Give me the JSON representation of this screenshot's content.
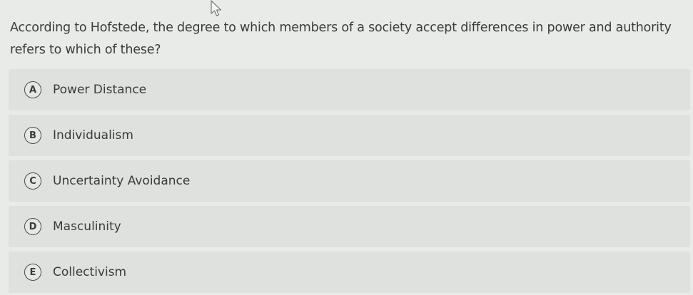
{
  "question": {
    "text": "According to Hofstede, the degree to which members of a society accept differences in power and authority refers to which of these?"
  },
  "options": [
    {
      "letter": "A",
      "label": "Power Distance"
    },
    {
      "letter": "B",
      "label": "Individualism"
    },
    {
      "letter": "C",
      "label": "Uncertainty Avoidance"
    },
    {
      "letter": "D",
      "label": "Masculinity"
    },
    {
      "letter": "E",
      "label": "Collectivism"
    }
  ],
  "colors": {
    "background": "#e9ebe8",
    "option_background": "#dfe1de",
    "text": "#3a3c3b"
  },
  "cursor": {
    "icon": "mouse-pointer-icon"
  }
}
